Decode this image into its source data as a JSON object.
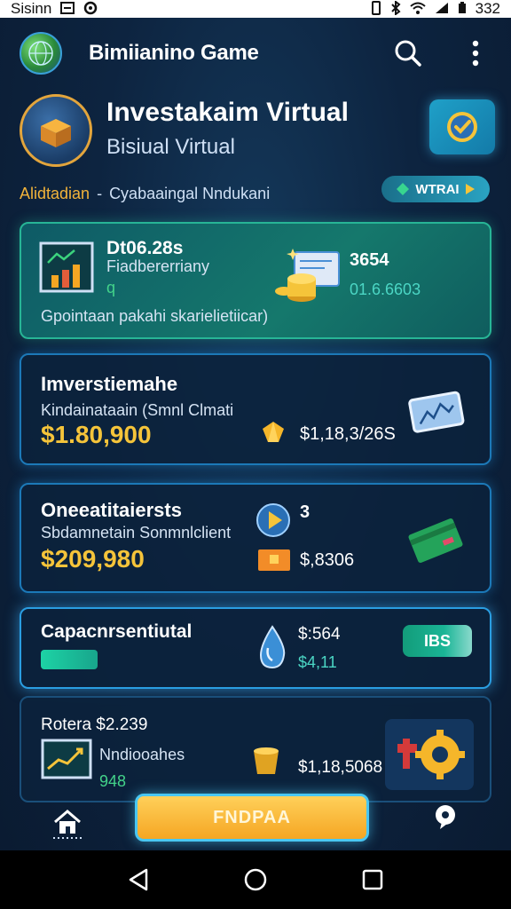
{
  "status_bar": {
    "carrier": "Sisinn",
    "time": "332"
  },
  "app_bar": {
    "title": "Bimiianino Game"
  },
  "hero": {
    "title": "Investakaim Virtual",
    "subtitle": "Bisiual Virtual",
    "crumb_primary": "Alidtadian",
    "crumb_sep": "-",
    "crumb_secondary": "Cyabaaingal Nndukani",
    "tag_label": "WTRAI"
  },
  "cards": [
    {
      "title": "Dt06.28s",
      "subtitle": "Fiadbererriany",
      "small_value": "q",
      "caption": "Gpointaan pakahi skarielietiicar)",
      "right_value": "3654",
      "right_sub": "01.6.6603"
    },
    {
      "title": "Imverstiemahe",
      "subtitle": "Kindainataain (Smnl Clmati",
      "amount": "$1.80,900",
      "right_value": "$1,18,3/26S"
    },
    {
      "title": "Oneeatitaiersts",
      "subtitle": "Sbdamnetain Sonmnlclient",
      "amount": "$209,980",
      "right_top": "3",
      "right_value": "$,8306"
    },
    {
      "title": "Capacnrsentiutal",
      "right_value": "$:564",
      "right_sub": "$4,11",
      "badge": "IBS"
    },
    {
      "title": "Rotera $2.239",
      "subtitle": "Nndiooahes",
      "small_value": "948",
      "right_value": "$1,18,5068"
    }
  ],
  "bottom": {
    "cta_label": "FNDPAA"
  },
  "colors": {
    "accent_gold": "#f5c43a",
    "accent_cyan": "#49c7f2",
    "card_border": "#1c79b8"
  }
}
